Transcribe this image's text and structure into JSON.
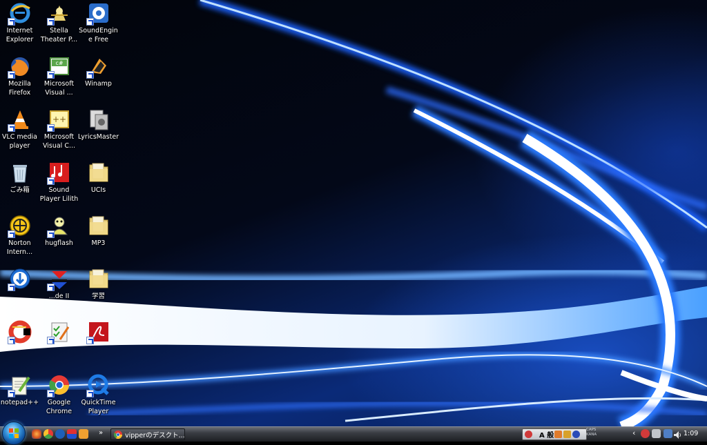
{
  "desktop": {
    "icons": [
      {
        "label": "Internet Explorer",
        "icon": "internet-explorer-icon"
      },
      {
        "label": "Stella Theater P...",
        "icon": "stella-theater-icon"
      },
      {
        "label": "SoundEngine Free",
        "icon": "soundengine-icon"
      },
      {
        "label": "Mozilla Firefox",
        "icon": "firefox-icon"
      },
      {
        "label": "Microsoft Visual ...",
        "icon": "visual-csharp-icon"
      },
      {
        "label": "Winamp",
        "icon": "winamp-icon"
      },
      {
        "label": "VLC media player",
        "icon": "vlc-icon"
      },
      {
        "label": "Microsoft Visual C...",
        "icon": "visual-cpp-icon"
      },
      {
        "label": "LyricsMaster",
        "icon": "lyricsmaster-icon"
      },
      {
        "label": "ごみ箱",
        "icon": "recycle-bin-icon"
      },
      {
        "label": "Sound Player Lilith",
        "icon": "lilith-icon"
      },
      {
        "label": "UCIs",
        "icon": "folder-icon"
      },
      {
        "label": "Norton Intern...",
        "icon": "norton-icon"
      },
      {
        "label": "hugflash",
        "icon": "hugflash-icon"
      },
      {
        "label": "MP3",
        "icon": "folder-icon"
      },
      {
        "label": "",
        "icon": "download-icon"
      },
      {
        "label": "...de II",
        "icon": "red-arrows-icon"
      },
      {
        "label": "学習",
        "icon": "folder-icon"
      },
      {
        "label": "",
        "icon": "ccleaner-icon"
      },
      {
        "label": "",
        "icon": "checklist-icon"
      },
      {
        "label": "",
        "icon": "acrobat-icon"
      },
      {
        "label": "notepad++",
        "icon": "notepadpp-icon"
      },
      {
        "label": "Google Chrome",
        "icon": "chrome-icon"
      },
      {
        "label": "QuickTime Player",
        "icon": "quicktime-icon"
      }
    ]
  },
  "taskbar": {
    "chevron": "»",
    "window_button": "vipperのデスクト...",
    "lang_mode": "A 般",
    "caps": "CAPS",
    "kana": "KANA",
    "tray_arrow": "‹",
    "clock": "1:09"
  }
}
